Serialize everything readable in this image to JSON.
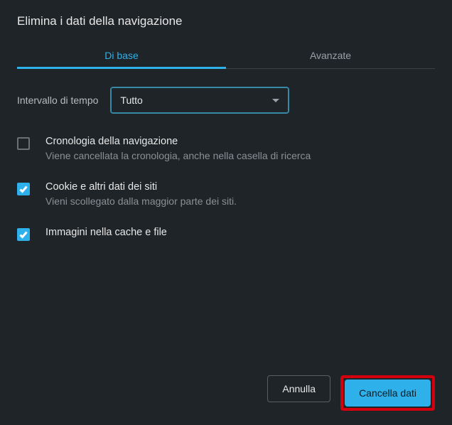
{
  "title": "Elimina i dati della navigazione",
  "tabs": {
    "basic": "Di base",
    "advanced": "Avanzate"
  },
  "timeRange": {
    "label": "Intervallo di tempo",
    "value": "Tutto"
  },
  "options": [
    {
      "title": "Cronologia della navigazione",
      "desc": "Viene cancellata la cronologia, anche nella casella di ricerca",
      "checked": false
    },
    {
      "title": "Cookie e altri dati dei siti",
      "desc": "Vieni scollegato dalla maggior parte dei siti.",
      "checked": true
    },
    {
      "title": "Immagini nella cache e file",
      "desc": "",
      "checked": true
    }
  ],
  "buttons": {
    "cancel": "Annulla",
    "confirm": "Cancella dati"
  }
}
